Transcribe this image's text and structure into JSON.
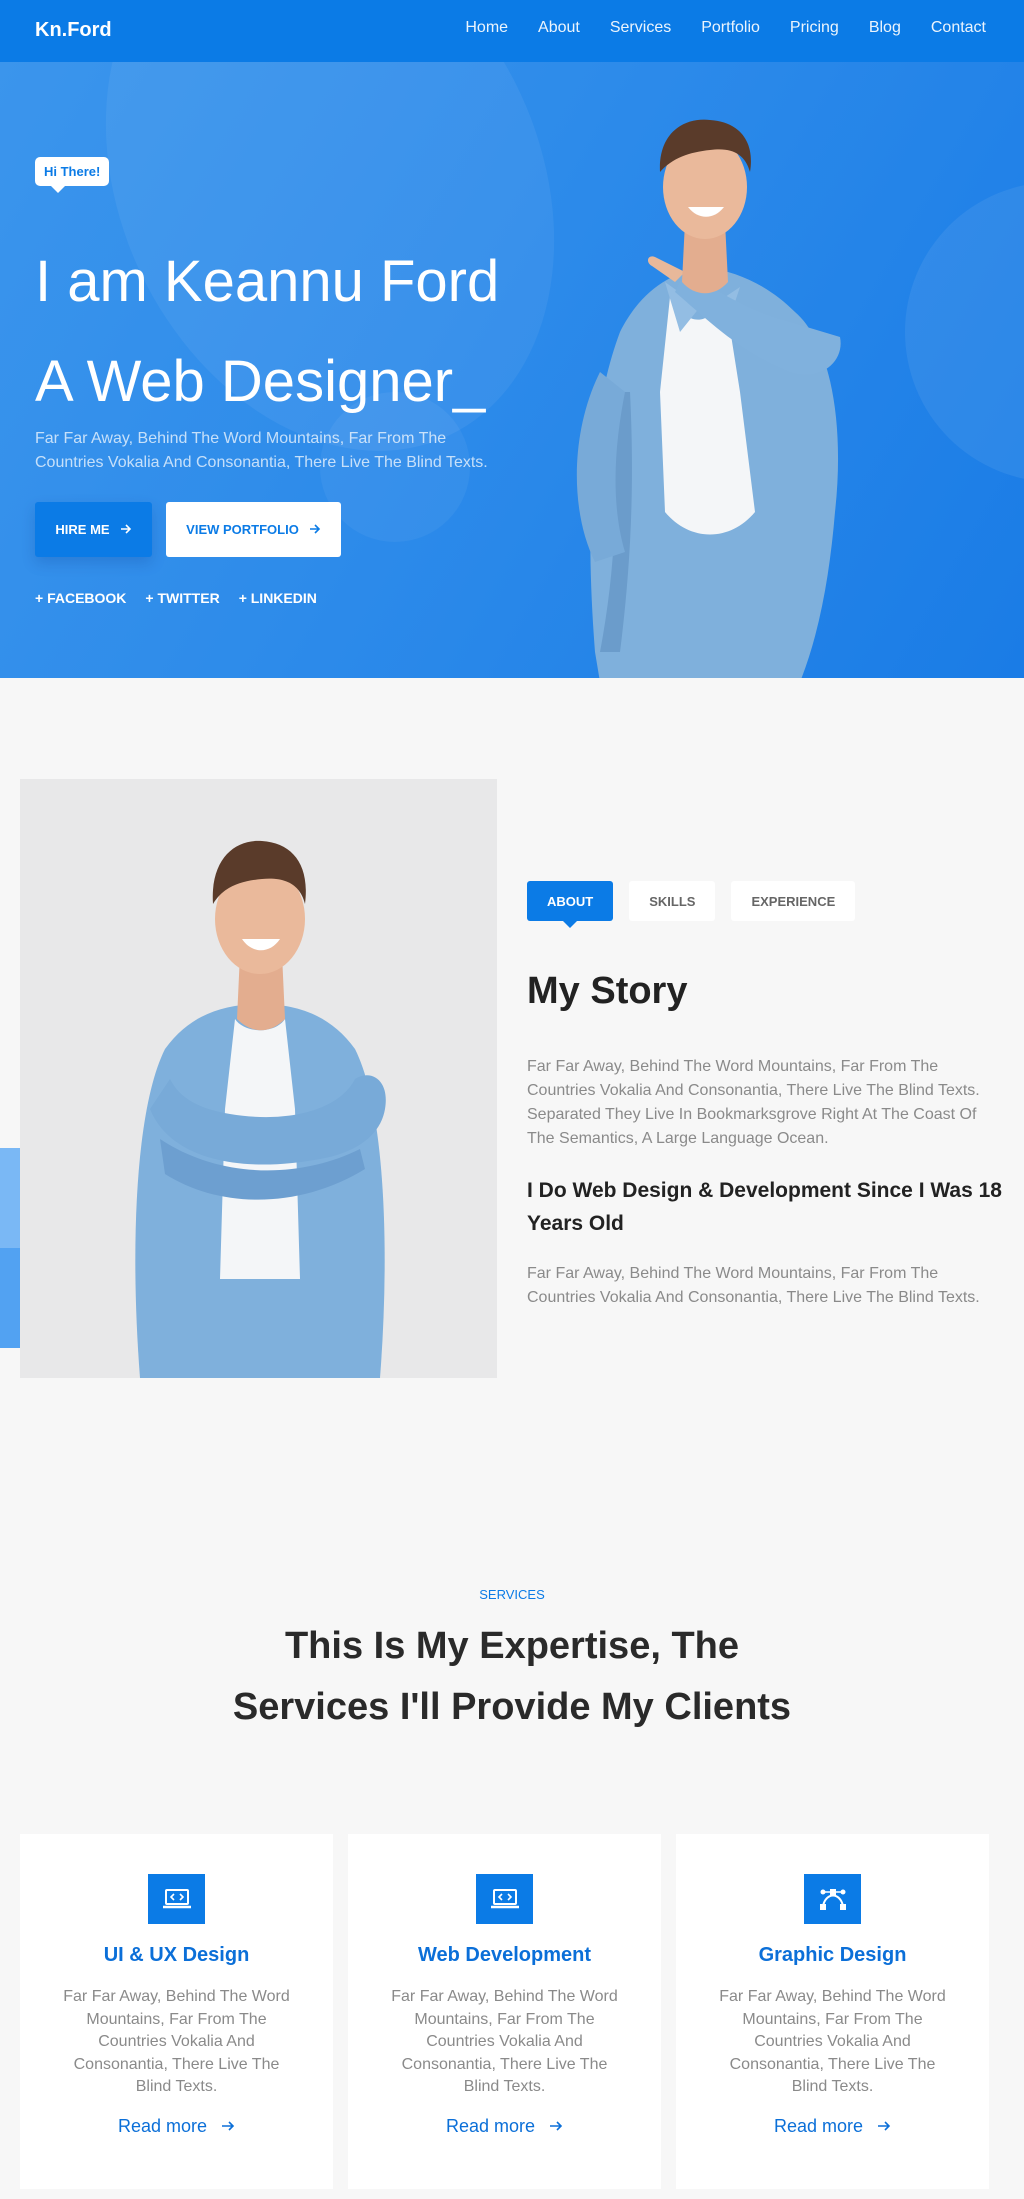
{
  "nav": {
    "brand": "Kn.Ford",
    "items": [
      "Home",
      "About",
      "Services",
      "Portfolio",
      "Pricing",
      "Blog",
      "Contact"
    ]
  },
  "hero": {
    "badge": "Hi There!",
    "title_line1": "I am Keannu Ford",
    "title_line2": "A Web Designer_",
    "text": "Far Far Away, Behind The Word Mountains, Far From The Countries Vokalia And Consonantia, There Live The Blind Texts.",
    "hire_label": "HIRE ME",
    "portfolio_label": "VIEW PORTFOLIO",
    "socials": [
      "+ FACEBOOK",
      "+ TWITTER",
      "+ LINKEDIN"
    ]
  },
  "about": {
    "tabs": [
      "ABOUT",
      "SKILLS",
      "EXPERIENCE"
    ],
    "active_tab": "ABOUT",
    "title": "My Story",
    "paragraph1": "Far Far Away, Behind The Word Mountains, Far From The Countries Vokalia And Consonantia, There Live The Blind Texts. Separated They Live In Bookmarksgrove Right At The Coast Of The Semantics, A Large Language Ocean.",
    "subtitle": "I Do Web Design & Development Since I Was 18 Years Old",
    "paragraph2": "Far Far Away, Behind The Word Mountains, Far From The Countries Vokalia And Consonantia, There Live The Blind Texts."
  },
  "services": {
    "tag": "SERVICES",
    "title_line1": "This Is My Expertise, The",
    "title_line2": "Services I'll Provide My Clients",
    "cards": [
      {
        "icon": "laptop-code-icon",
        "title": "UI & UX Design",
        "text": "Far Far Away, Behind The Word Mountains, Far From The Countries Vokalia And Consonantia, There Live The Blind Texts.",
        "link": "Read more"
      },
      {
        "icon": "laptop-code-icon",
        "title": "Web Development",
        "text": "Far Far Away, Behind The Word Mountains, Far From The Countries Vokalia And Consonantia, There Live The Blind Texts.",
        "link": "Read more"
      },
      {
        "icon": "bezier-curve-icon",
        "title": "Graphic Design",
        "text": "Far Far Away, Behind The Word Mountains, Far From The Countries Vokalia And Consonantia, There Live The Blind Texts.",
        "link": "Read more"
      }
    ]
  },
  "colors": {
    "primary": "#0b7be6",
    "background": "#f7f7f7",
    "text_dark": "#222222",
    "text_muted": "#8a8a8a"
  }
}
